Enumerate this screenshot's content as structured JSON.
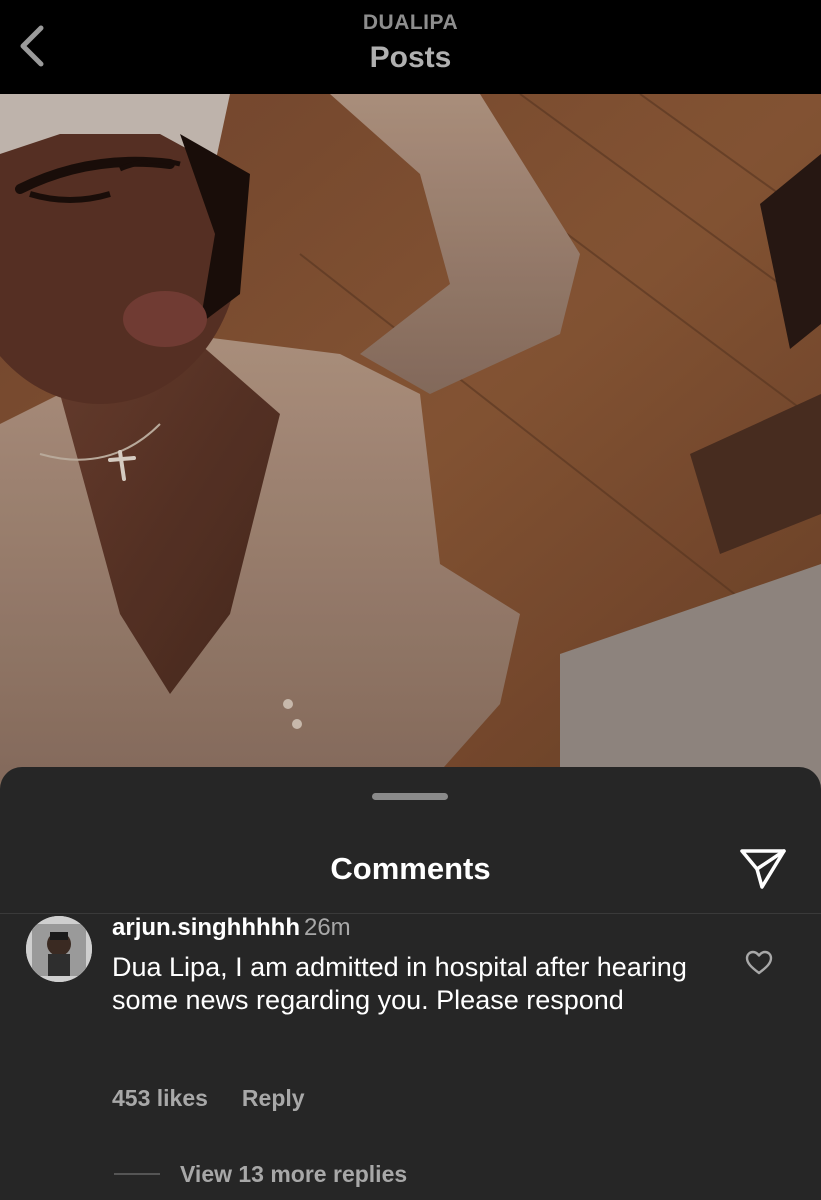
{
  "header": {
    "account_name": "DUALIPA",
    "screen_title": "Posts",
    "back_icon": "chevron-left-icon"
  },
  "post": {
    "image_icon": "post-photo"
  },
  "comments_sheet": {
    "title": "Comments",
    "share_icon": "paper-plane-icon",
    "comment": {
      "username": "arjun.singhhhhh",
      "time_ago": "26m",
      "text": "Dua Lipa, I am admitted in hospital after hearing some news regarding you. Please respond",
      "likes": "453 likes",
      "reply_label": "Reply",
      "like_icon": "heart-outline-icon"
    },
    "view_replies_label": "View 13 more replies"
  },
  "colors": {
    "background": "#000000",
    "sheet": "#262626",
    "secondary_text": "#a8a8a8"
  }
}
